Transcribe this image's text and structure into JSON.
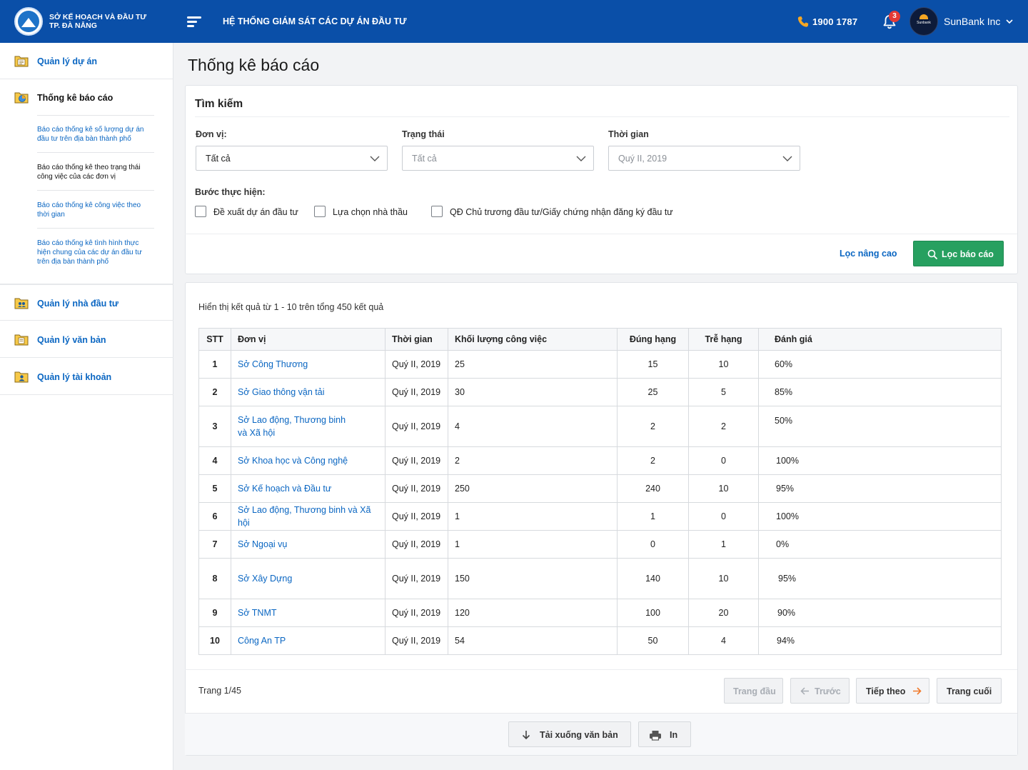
{
  "header": {
    "org_line1": "SỞ KẾ HOẠCH VÀ ĐẦU TƯ",
    "org_line2": "TP. ĐÀ NẴNG",
    "system_title": "HỆ THỐNG GIÁM SÁT CÁC DỰ ÁN ĐẦU TƯ",
    "phone": "1900 1787",
    "notification_count": "3",
    "avatar_text": "Sunbank",
    "user_name": "SunBank Inc"
  },
  "sidebar": {
    "items": [
      {
        "label": "Quản lý dự án"
      },
      {
        "label": "Thống kê báo cáo"
      },
      {
        "label": "Quản lý nhà đầu tư"
      },
      {
        "label": "Quản lý văn bản"
      },
      {
        "label": "Quản lý tài khoản"
      }
    ],
    "sub_items": [
      {
        "label": "Báo cáo thống kê số lượng dự án đầu tư trên địa bàn thành phố"
      },
      {
        "label": "Báo cáo thống kê theo trạng thái công việc của các đơn vị"
      },
      {
        "label": "Báo cáo thống kê công việc theo thời gian"
      },
      {
        "label": "Báo cáo thống kê tình hình thực hiện chung của các dự án đầu tư trên địa bàn thành phố"
      }
    ]
  },
  "page": {
    "title": "Thống kê báo cáo"
  },
  "search": {
    "title": "Tìm kiếm",
    "unit_label": "Đơn vị:",
    "unit_value": "Tất cả",
    "status_label": "Trạng thái",
    "status_value": "Tất cả",
    "time_label": "Thời gian",
    "time_value": "Quý II, 2019",
    "steps_label": "Bước thực hiện:",
    "steps": [
      {
        "label": "Đề xuất dự án đầu tư",
        "checked": false
      },
      {
        "label": "Lựa chọn nhà thầu",
        "checked": false
      },
      {
        "label": "QĐ Chủ trương đầu tư/Giấy chứng nhận đăng ký đầu tư",
        "checked": false
      }
    ],
    "advanced_link": "Lọc nâng cao",
    "filter_button": "Lọc báo cáo"
  },
  "results": {
    "info": "Hiển thị kết quả từ 1 - 10 trên tổng 450 kết quả",
    "columns": [
      "STT",
      "Đơn vị",
      "Thời gian",
      "Khối lượng công việc",
      "Đúng hạng",
      "Trễ hạng",
      "Đánh giá"
    ],
    "rows": [
      {
        "stt": "1",
        "unit": "Sở Công Thương",
        "time": "Quý II, 2019",
        "workload": "25",
        "on_time": "15",
        "late": "10",
        "rating": "60%"
      },
      {
        "stt": "2",
        "unit": "Sở Giao thông vận tải",
        "time": "Quý II, 2019",
        "workload": "30",
        "on_time": "25",
        "late": "5",
        "rating": "85%"
      },
      {
        "stt": "3",
        "unit": "Sở Lao động, Thương binh và Xã hội",
        "time": "Quý II, 2019",
        "workload": "4",
        "on_time": "2",
        "late": "2",
        "rating": "50%"
      },
      {
        "stt": "4",
        "unit": "Sở Khoa học và Công nghệ",
        "time": "Quý II, 2019",
        "workload": "2",
        "on_time": "2",
        "late": "0",
        "rating": "100%"
      },
      {
        "stt": "5",
        "unit": "Sở Kế hoạch và Đầu tư",
        "time": "Quý II, 2019",
        "workload": "250",
        "on_time": "240",
        "late": "10",
        "rating": "95%"
      },
      {
        "stt": "6",
        "unit": "Sở Lao động, Thương binh và Xã hội",
        "time": "Quý II, 2019",
        "workload": "1",
        "on_time": "1",
        "late": "0",
        "rating": "100%"
      },
      {
        "stt": "7",
        "unit": "Sở Ngoại vụ",
        "time": "Quý II, 2019",
        "workload": "1",
        "on_time": "0",
        "late": "1",
        "rating": "0%"
      },
      {
        "stt": "8",
        "unit": "Sở Xây Dựng",
        "time": "Quý II, 2019",
        "workload": "150",
        "on_time": "140",
        "late": "10",
        "rating": "95%"
      },
      {
        "stt": "9",
        "unit": "Sở TNMT",
        "time": "Quý II, 2019",
        "workload": "120",
        "on_time": "100",
        "late": "20",
        "rating": "90%"
      },
      {
        "stt": "10",
        "unit": "Công An TP",
        "time": "Quý II, 2019",
        "workload": "54",
        "on_time": "50",
        "late": "4",
        "rating": "94%"
      }
    ]
  },
  "pagination": {
    "page_label": "Trang 1/45",
    "first": "Trang đầu",
    "prev": "Trước",
    "next": "Tiếp theo",
    "last": "Trang cuối"
  },
  "actions": {
    "download": "Tải xuống văn bản",
    "print": "In"
  },
  "colors": {
    "header_bg": "#0a4fa8",
    "link": "#0a66c2",
    "primary_button": "#27a060",
    "badge": "#e53935",
    "accent_orange": "#f5a623"
  }
}
